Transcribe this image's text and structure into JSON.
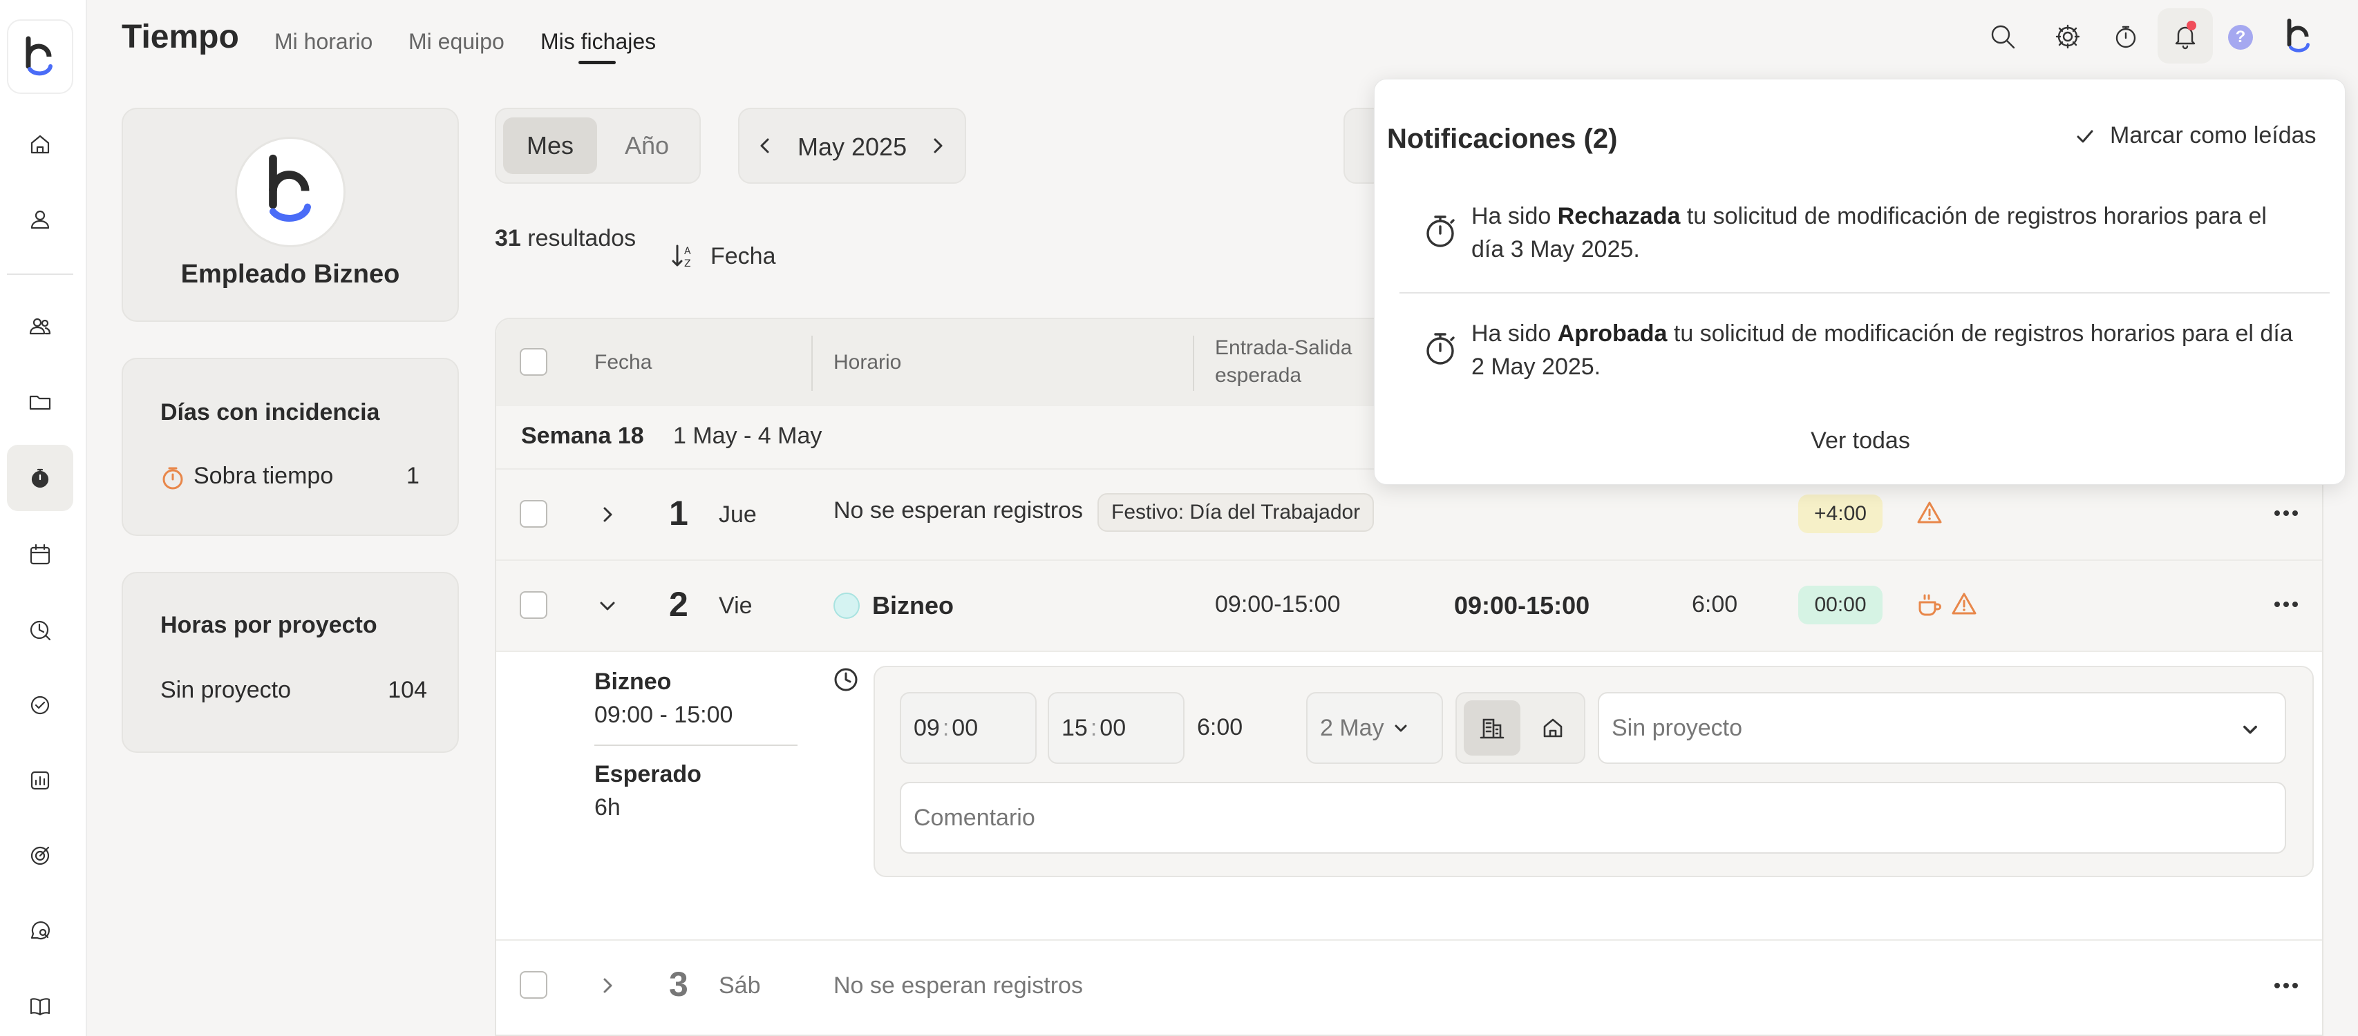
{
  "header": {
    "title": "Tiempo",
    "tabs": [
      {
        "label": "Mi horario",
        "active": false
      },
      {
        "label": "Mi equipo",
        "active": false
      },
      {
        "label": "Mis fichajes",
        "active": true
      }
    ],
    "icons": [
      "search-icon",
      "gear-icon",
      "stopwatch-icon",
      "bell-icon",
      "help-icon",
      "user-logo"
    ]
  },
  "sidebar": {
    "icons": [
      "logo",
      "home-icon",
      "person-icon",
      "team-icon",
      "folder-icon",
      "stopwatch-icon",
      "calendar-icon",
      "clock-pie-icon",
      "check-circle-icon",
      "report-icon",
      "target-icon",
      "chat-search-icon",
      "book-icon"
    ],
    "active": "stopwatch-icon"
  },
  "profile": {
    "name": "Empleado Bizneo"
  },
  "incidencias": {
    "title": "Días con incidencia",
    "items": [
      {
        "label": "Sobra tiempo",
        "count": "1"
      }
    ]
  },
  "proyectos": {
    "title": "Horas por proyecto",
    "items": [
      {
        "label": "Sin proyecto",
        "count": "104"
      }
    ]
  },
  "period": {
    "modes": [
      {
        "label": "Mes",
        "selected": true
      },
      {
        "label": "Año",
        "selected": false
      }
    ],
    "current": "May 2025"
  },
  "results": {
    "count": "31",
    "label": "resultados",
    "sort_label": "Fecha"
  },
  "table": {
    "headers": {
      "fecha": "Fecha",
      "horario": "Horario",
      "entrada": "Entrada-Salida esperada"
    },
    "week": {
      "label": "Semana 18",
      "range": "1 May - 4 May"
    },
    "rows": [
      {
        "num": "1",
        "day": "Jue",
        "text": "No se esperan registros",
        "tag": "Festivo: Día del Trabajador",
        "pill": "+4:00"
      },
      {
        "num": "2",
        "day": "Vie",
        "schedule": "Bizneo",
        "expected": "09:00-15:00",
        "actual": "09:00-15:00",
        "hours": "6:00",
        "pill": "00:00"
      },
      {
        "num": "3",
        "day": "Sáb",
        "text": "No se esperan registros"
      }
    ],
    "detail": {
      "schedule_name": "Bizneo",
      "schedule_time": "09:00 - 15:00",
      "expected_label": "Esperado",
      "expected_value": "6h",
      "start_h": "09",
      "start_m": "00",
      "end_h": "15",
      "end_m": "00",
      "duration": "6:00",
      "date": "2 May",
      "project_placeholder": "Sin proyecto",
      "comment_placeholder": "Comentario"
    }
  },
  "notifications": {
    "title": "Notificaciones (2)",
    "mark_read": "Marcar como leídas",
    "items": [
      {
        "pre": "Ha sido ",
        "status": "Rechazada",
        "post": " tu solicitud de modificación de registros horarios para el día 3 May 2025."
      },
      {
        "pre": "Ha sido ",
        "status": "Aprobada",
        "post": " tu solicitud de modificación de registros horarios para el día 2 May 2025."
      }
    ],
    "see_all": "Ver todas"
  },
  "colors": {
    "accent": "#4a6cf7",
    "warning": "#e8874a",
    "pill_yellow": "#f6f0c8",
    "pill_green": "#d6f3e4"
  }
}
